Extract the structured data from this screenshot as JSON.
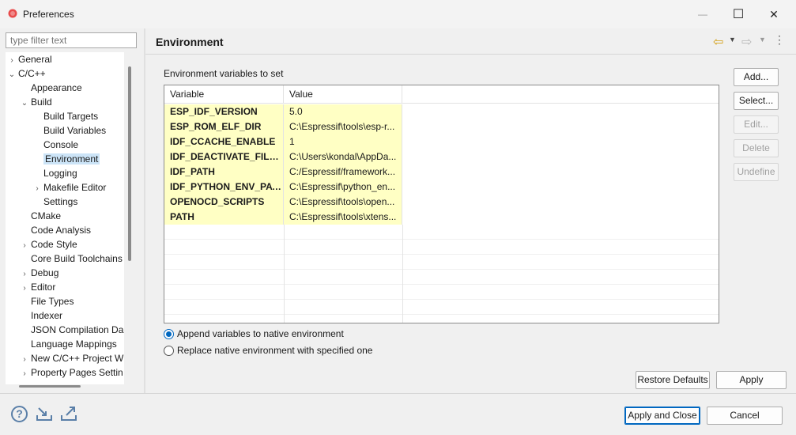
{
  "window": {
    "title": "Preferences",
    "minimize_glyph": "—",
    "maximize_glyph": "☐",
    "close_glyph": "✕"
  },
  "filter": {
    "placeholder": "type filter text"
  },
  "tree": [
    {
      "label": "General",
      "chevron": "›",
      "level": 0
    },
    {
      "label": "C/C++",
      "chevron": "⌄",
      "level": 0
    },
    {
      "label": "Appearance",
      "chevron": "",
      "level": 1
    },
    {
      "label": "Build",
      "chevron": "⌄",
      "level": 1
    },
    {
      "label": "Build Targets",
      "chevron": "",
      "level": 2
    },
    {
      "label": "Build Variables",
      "chevron": "",
      "level": 2
    },
    {
      "label": "Console",
      "chevron": "",
      "level": 2
    },
    {
      "label": "Environment",
      "chevron": "",
      "level": 2,
      "selected": true
    },
    {
      "label": "Logging",
      "chevron": "",
      "level": 2
    },
    {
      "label": "Makefile Editor",
      "chevron": "›",
      "level": 2
    },
    {
      "label": "Settings",
      "chevron": "",
      "level": 2
    },
    {
      "label": "CMake",
      "chevron": "",
      "level": 1
    },
    {
      "label": "Code Analysis",
      "chevron": "",
      "level": 1
    },
    {
      "label": "Code Style",
      "chevron": "›",
      "level": 1
    },
    {
      "label": "Core Build Toolchains",
      "chevron": "",
      "level": 1
    },
    {
      "label": "Debug",
      "chevron": "›",
      "level": 1
    },
    {
      "label": "Editor",
      "chevron": "›",
      "level": 1
    },
    {
      "label": "File Types",
      "chevron": "",
      "level": 1
    },
    {
      "label": "Indexer",
      "chevron": "",
      "level": 1
    },
    {
      "label": "JSON Compilation Da",
      "chevron": "",
      "level": 1
    },
    {
      "label": "Language Mappings",
      "chevron": "",
      "level": 1
    },
    {
      "label": "New C/C++ Project W",
      "chevron": "›",
      "level": 1
    },
    {
      "label": "Property Pages Settin",
      "chevron": "›",
      "level": 1
    }
  ],
  "page": {
    "title": "Environment",
    "section_label": "Environment variables to set",
    "nav": {
      "back_glyph": "⇦",
      "forward_glyph": "⇨",
      "dropdown_glyph": "▼",
      "menu_glyph": "⋮"
    }
  },
  "table": {
    "columns": [
      "Variable",
      "Value"
    ],
    "rows": [
      {
        "variable": "ESP_IDF_VERSION",
        "value": "5.0"
      },
      {
        "variable": "ESP_ROM_ELF_DIR",
        "value": "C:\\Espressif\\tools\\esp-r..."
      },
      {
        "variable": "IDF_CCACHE_ENABLE",
        "value": "1"
      },
      {
        "variable": "IDF_DEACTIVATE_FILE_P...",
        "value": "C:\\Users\\kondal\\AppDa..."
      },
      {
        "variable": "IDF_PATH",
        "value": "C:/Espressif/framework..."
      },
      {
        "variable": "IDF_PYTHON_ENV_PATH",
        "value": "C:\\Espressif\\python_en..."
      },
      {
        "variable": "OPENOCD_SCRIPTS",
        "value": "C:\\Espressif\\tools\\open..."
      },
      {
        "variable": "PATH",
        "value": "C:\\Espressif\\tools\\xtens..."
      }
    ]
  },
  "side_buttons": {
    "add": "Add...",
    "select": "Select...",
    "edit": "Edit...",
    "delete": "Delete",
    "undefine": "Undefine"
  },
  "radios": {
    "append": "Append variables to native environment",
    "replace": "Replace native environment with specified one",
    "selected": "append"
  },
  "buttons": {
    "restore_defaults": "Restore Defaults",
    "apply": "Apply",
    "apply_and_close": "Apply and Close",
    "cancel": "Cancel"
  },
  "bottom_icons": {
    "help": "help-icon",
    "import": "import-icon",
    "export": "export-icon",
    "help_glyph": "?"
  },
  "colors": {
    "accent": "#0067c0",
    "row_highlight": "#ffffc4",
    "selection": "#cce4f7"
  }
}
